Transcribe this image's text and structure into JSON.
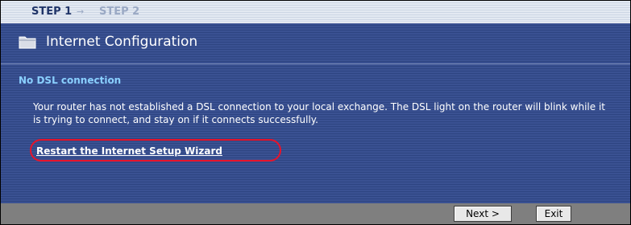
{
  "steps": {
    "step1": "STEP 1",
    "separator": "→",
    "step2": "STEP 2"
  },
  "header": {
    "title": "Internet Configuration",
    "icon": "folder-icon"
  },
  "content": {
    "subheading": "No DSL connection",
    "message": "Your router has not established a DSL connection to your local exchange. The DSL light on the router will blink while it is trying to connect, and stay on if it connects successfully.",
    "restart_link": "Restart the Internet Setup Wizard"
  },
  "buttons": {
    "next": "Next >",
    "exit": "Exit"
  },
  "colors": {
    "panel": "#34498a",
    "subheading": "#8ad0ff",
    "highlight_circle": "#e8132a",
    "footer": "#7f7f7f"
  }
}
